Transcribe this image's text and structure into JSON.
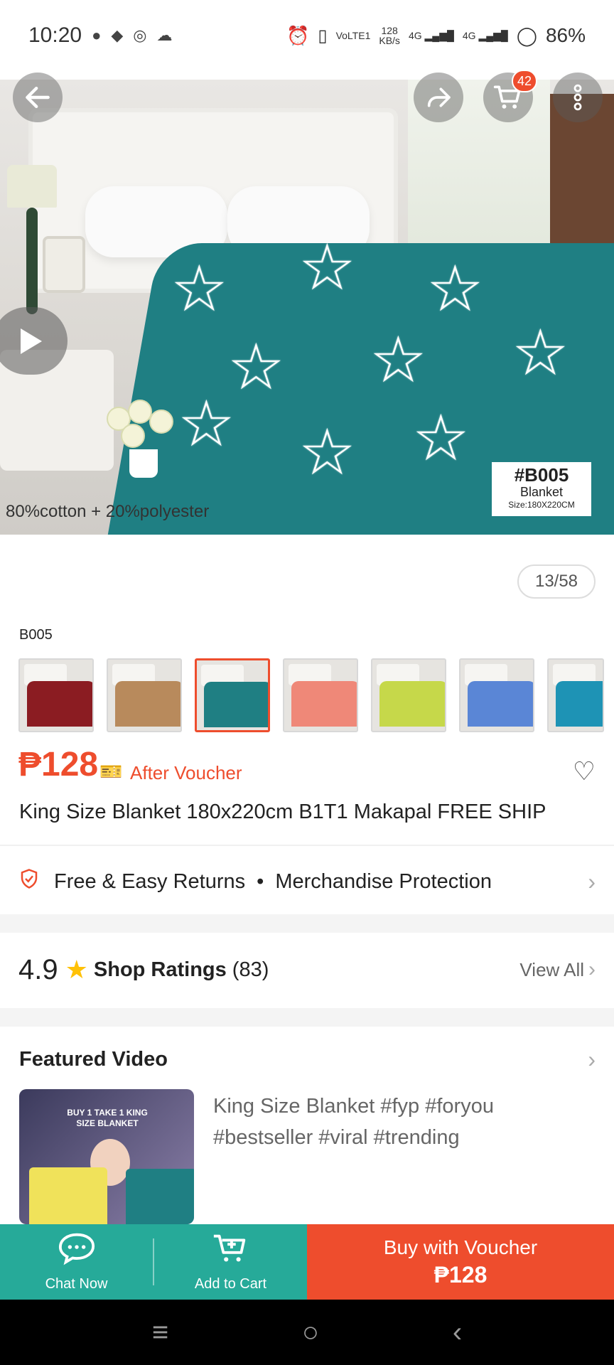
{
  "status_bar": {
    "time": "10:20",
    "network_speed_value": "128",
    "network_speed_unit": "KB/s",
    "volte": "VoLTE1",
    "net1": "4G",
    "net2": "4G",
    "battery": "86%"
  },
  "product_gallery": {
    "caption": "80%cotton + 20%polyester",
    "label_code": "#B005",
    "label_type": "Blanket",
    "label_size": "Size:180X220CM",
    "counter": "13/58",
    "cart_badge": "42"
  },
  "variants": {
    "selected_label": "B005",
    "thumbnails": [
      {
        "color": "#8b1c22"
      },
      {
        "color": "#b88a5c"
      },
      {
        "color": "#1f7f83",
        "selected": true
      },
      {
        "color": "#ef8878"
      },
      {
        "color": "#c6d84a"
      },
      {
        "color": "#5a86d6"
      },
      {
        "color": "#1e93b5"
      }
    ]
  },
  "pricing": {
    "price": "₱128",
    "after_voucher": "After Voucher"
  },
  "product": {
    "title": "King Size Blanket 180x220cm B1T1 Makapal FREE SHIP"
  },
  "guarantees": {
    "returns": "Free & Easy Returns",
    "separator": "•",
    "protection": "Merchandise Protection"
  },
  "shop_ratings": {
    "value": "4.9",
    "label": "Shop Ratings",
    "count": "(83)",
    "view_all": "View All"
  },
  "featured_video": {
    "title": "Featured Video",
    "thumb_caption": "BUY 1 TAKE 1 KING SIZE BLANKET",
    "description": "King Size Blanket #fyp #foryou #bestseller #viral #trending"
  },
  "actions": {
    "chat": "Chat Now",
    "add_to_cart": "Add to Cart",
    "buy_line1": "Buy with Voucher",
    "buy_line2": "₱128"
  },
  "colors": {
    "accent": "#ee4d2d",
    "green": "#26aa99",
    "rating_star": "#ffc107"
  }
}
